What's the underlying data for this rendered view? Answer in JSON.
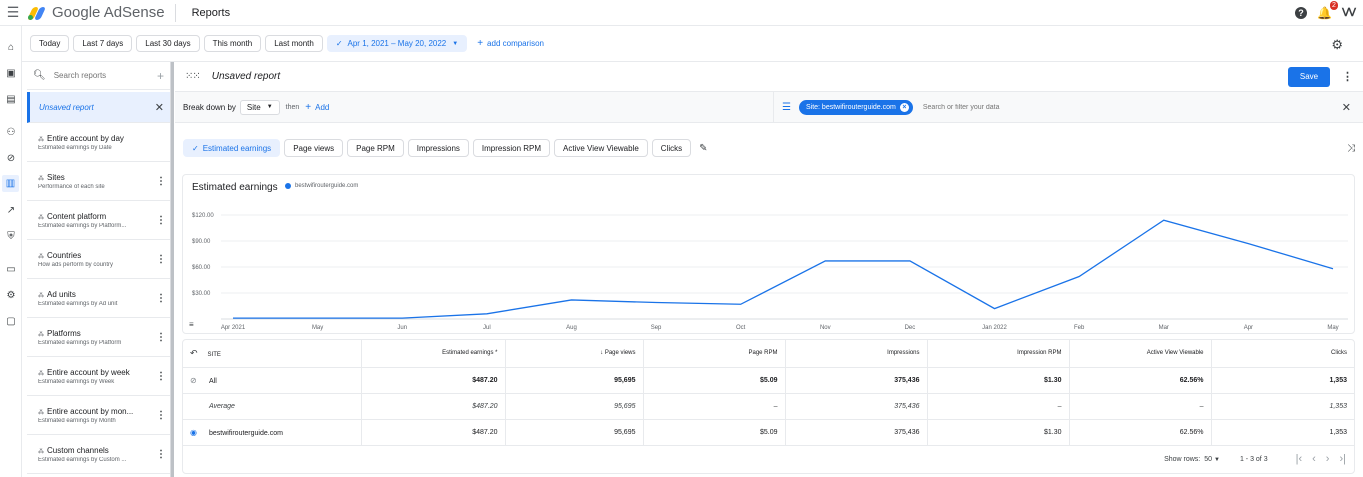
{
  "topbar": {
    "product": "Google AdSense",
    "page": "Reports",
    "notification_count": "2"
  },
  "date_filters": {
    "today": "Today",
    "last7": "Last 7 days",
    "last30": "Last 30 days",
    "this_month": "This month",
    "last_month": "Last month",
    "range": "Apr 1, 2021 – May 20, 2022",
    "add_comparison": "add comparison"
  },
  "reports_panel": {
    "search_placeholder": "Search reports",
    "items": [
      {
        "title": "Unsaved report",
        "sub": ""
      },
      {
        "title": "Entire account by day",
        "sub": "Estimated earnings by Date"
      },
      {
        "title": "Sites",
        "sub": "Performance of each site"
      },
      {
        "title": "Content platform",
        "sub": "Estimated earnings by Platform..."
      },
      {
        "title": "Countries",
        "sub": "How ads perform by country"
      },
      {
        "title": "Ad units",
        "sub": "Estimated earnings by Ad unit"
      },
      {
        "title": "Platforms",
        "sub": "Estimated earnings by Platform"
      },
      {
        "title": "Entire account by week",
        "sub": "Estimated earnings by Week"
      },
      {
        "title": "Entire account by mon...",
        "sub": "Estimated earnings by Month"
      },
      {
        "title": "Custom channels",
        "sub": "Estimated earnings by Custom ..."
      }
    ]
  },
  "report": {
    "title": "Unsaved report",
    "save_label": "Save",
    "breakdown_label": "Break down by",
    "breakdown_value": "Site",
    "then_label": "then",
    "add_label": "Add",
    "filter_chip": "Site: bestwifirouterguide.com",
    "filter_placeholder": "Search or filter your data"
  },
  "metrics": [
    {
      "label": "Estimated earnings",
      "selected": true
    },
    {
      "label": "Page views",
      "selected": false
    },
    {
      "label": "Page RPM",
      "selected": false
    },
    {
      "label": "Impressions",
      "selected": false
    },
    {
      "label": "Impression RPM",
      "selected": false
    },
    {
      "label": "Active View Viewable",
      "selected": false
    },
    {
      "label": "Clicks",
      "selected": false
    }
  ],
  "chart_data": {
    "type": "line",
    "title": "Estimated earnings",
    "legend": "bestwifirouterguide.com",
    "color": "#1a73e8",
    "y_ticks": [
      "$120.00",
      "$90.00",
      "$60.00",
      "$30.00"
    ],
    "y_tick_values": [
      120,
      90,
      60,
      30
    ],
    "ylim": [
      0,
      120
    ],
    "x": [
      "Apr 2021",
      "May",
      "Jun",
      "Jul",
      "Aug",
      "Sep",
      "Oct",
      "Nov",
      "Dec",
      "Jan 2022",
      "Feb",
      "Mar",
      "Apr",
      "May"
    ],
    "series": [
      {
        "name": "bestwifirouterguide.com",
        "values": [
          1,
          1,
          1,
          6,
          22,
          19,
          17,
          67,
          67,
          12,
          49,
          114,
          87,
          58
        ]
      }
    ]
  },
  "table": {
    "columns": [
      "SITE",
      "Estimated earnings",
      "Page views",
      "Page RPM",
      "Impressions",
      "Impression RPM",
      "Active View Viewable",
      "Clicks"
    ],
    "rows": [
      {
        "site": "All",
        "values": [
          "$487.20",
          "95,695",
          "$5.09",
          "375,436",
          "$1.30",
          "62.56%",
          "1,353"
        ]
      },
      {
        "site": "Average",
        "values": [
          "$487.20",
          "95,695",
          "–",
          "375,436",
          "–",
          "–",
          "1,353"
        ]
      },
      {
        "site": "bestwifirouterguide.com",
        "values": [
          "$487.20",
          "95,695",
          "$5.09",
          "375,436",
          "$1.30",
          "62.56%",
          "1,353"
        ]
      }
    ],
    "show_rows_label": "Show rows:",
    "rows_per_page": "50",
    "range": "1 - 3 of 3"
  }
}
